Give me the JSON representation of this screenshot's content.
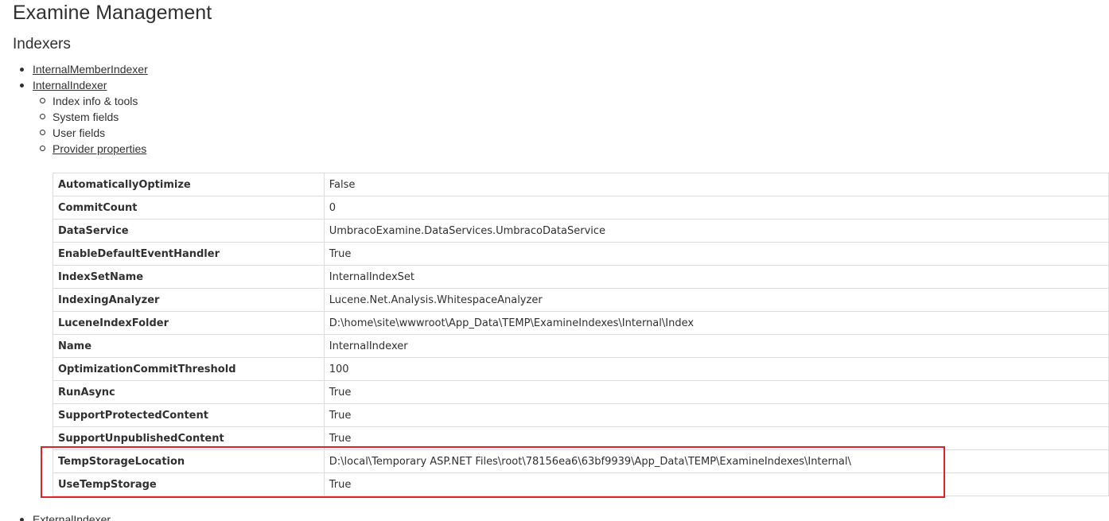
{
  "page": {
    "title": "Examine Management",
    "section_title": "Indexers"
  },
  "indexers": {
    "items": [
      {
        "label": "InternalMemberIndexer"
      },
      {
        "label": "InternalIndexer"
      }
    ],
    "sub_items": [
      {
        "label": "Index info & tools"
      },
      {
        "label": "System fields"
      },
      {
        "label": "User fields"
      },
      {
        "label": "Provider properties"
      }
    ],
    "bottom_item": "ExternalIndexer"
  },
  "properties": {
    "rows": [
      {
        "key": "AutomaticallyOptimize",
        "value": "False"
      },
      {
        "key": "CommitCount",
        "value": "0"
      },
      {
        "key": "DataService",
        "value": "UmbracoExamine.DataServices.UmbracoDataService"
      },
      {
        "key": "EnableDefaultEventHandler",
        "value": "True"
      },
      {
        "key": "IndexSetName",
        "value": "InternalIndexSet"
      },
      {
        "key": "IndexingAnalyzer",
        "value": "Lucene.Net.Analysis.WhitespaceAnalyzer"
      },
      {
        "key": "LuceneIndexFolder",
        "value": "D:\\home\\site\\wwwroot\\App_Data\\TEMP\\ExamineIndexes\\Internal\\Index"
      },
      {
        "key": "Name",
        "value": "InternalIndexer"
      },
      {
        "key": "OptimizationCommitThreshold",
        "value": "100"
      },
      {
        "key": "RunAsync",
        "value": "True"
      },
      {
        "key": "SupportProtectedContent",
        "value": "True"
      },
      {
        "key": "SupportUnpublishedContent",
        "value": "True"
      },
      {
        "key": "TempStorageLocation",
        "value": "D:\\local\\Temporary ASP.NET Files\\root\\78156ea6\\63bf9939\\App_Data\\TEMP\\ExamineIndexes\\Internal\\"
      },
      {
        "key": "UseTempStorage",
        "value": "True"
      }
    ]
  },
  "colors": {
    "highlight": "#d9252a",
    "border": "#dddddd",
    "text": "#303033"
  }
}
